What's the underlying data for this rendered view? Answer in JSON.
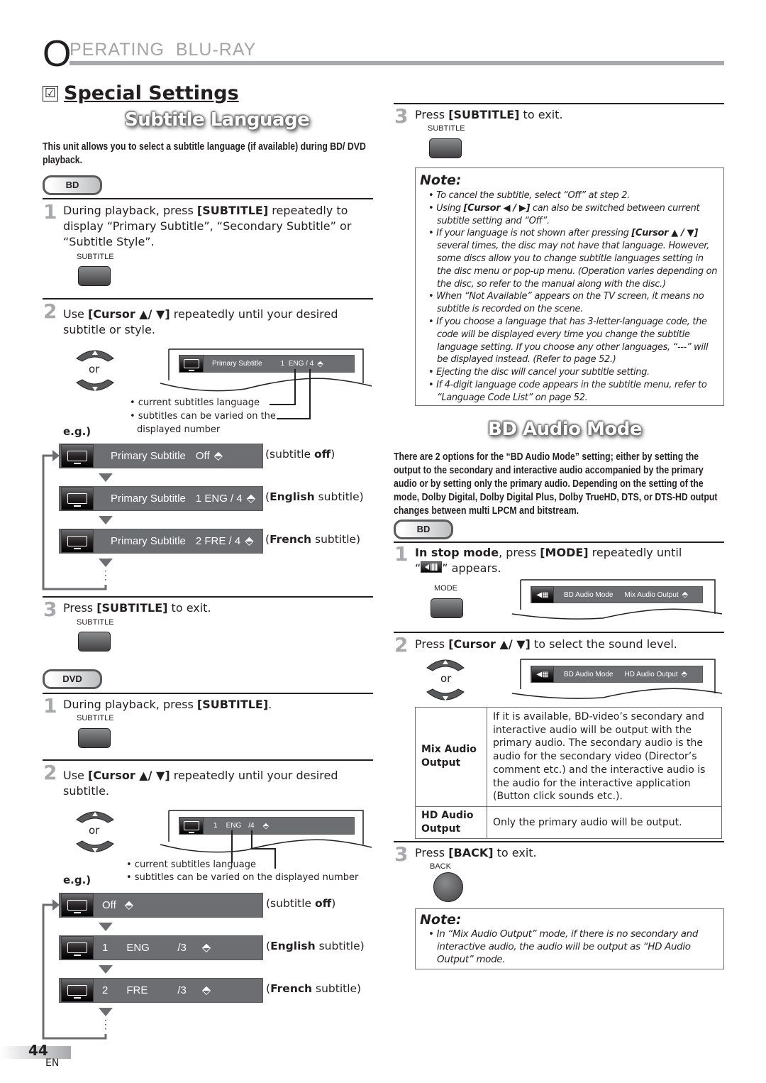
{
  "header": {
    "initial": "O",
    "rest": "PERATING  BLU-RAY"
  },
  "section": {
    "checkbox": "☑",
    "title": "Special Settings"
  },
  "subtitle_language": {
    "banner": "Subtitle Language",
    "intro": "This unit allows you to select a subtitle language (if available) during BD/ DVD playback.",
    "bd": {
      "badge": "BD",
      "step1": {
        "num": "1",
        "text_before": "During playback, press ",
        "key": "[SUBTITLE]",
        "text_after": " repeatedly to display “Primary Subtitle”, “Secondary Subtitle” or “Subtitle Style”.",
        "key_label": "SUBTITLE"
      },
      "step2": {
        "num": "2",
        "text_before": "Use ",
        "key": "[Cursor ▲/ ▼]",
        "text_after": " repeatedly until your desired subtitle or style.",
        "or": "or",
        "osd": {
          "label": "Primary Subtitle",
          "value": "1  ENG / 4"
        },
        "callout_1": "• current subtitles language",
        "callout_2": "• subtitles can be varied on the",
        "callout_3": "displayed number",
        "eg": "e.g.)",
        "examples": [
          {
            "label": "Primary Subtitle",
            "value": "Off",
            "caption_pre": "(subtitle ",
            "caption_bold": "off",
            "caption_post": ")"
          },
          {
            "label": "Primary Subtitle",
            "value": "1 ENG / 4",
            "caption_pre": "(",
            "caption_bold": "English",
            "caption_post": " subtitle)"
          },
          {
            "label": "Primary Subtitle",
            "value": "2 FRE / 4",
            "caption_pre": "(",
            "caption_bold": "French",
            "caption_post": " subtitle)"
          }
        ]
      },
      "step3": {
        "num": "3",
        "text_before": "Press ",
        "key": "[SUBTITLE]",
        "text_after": " to exit.",
        "key_label": "SUBTITLE"
      }
    },
    "dvd": {
      "badge": "DVD",
      "step1": {
        "num": "1",
        "text_before": "During playback, press ",
        "key": "[SUBTITLE]",
        "text_after": ".",
        "key_label": "SUBTITLE"
      },
      "step2": {
        "num": "2",
        "text_before": "Use ",
        "key": "[Cursor ▲/ ▼]",
        "text_after": " repeatedly until your desired subtitle.",
        "or": "or",
        "osd": {
          "num": "1",
          "lang": "ENG",
          "total": "/4"
        },
        "callout_1": "• current subtitles language",
        "callout_2": "• subtitles can be varied on the displayed number",
        "eg": "e.g.)",
        "examples": [
          {
            "num": "Off",
            "lang": "",
            "total": "",
            "caption_pre": "(subtitle ",
            "caption_bold": "off",
            "caption_post": ")"
          },
          {
            "num": "1",
            "lang": "ENG",
            "total": "/3",
            "caption_pre": "(",
            "caption_bold": "English",
            "caption_post": " subtitle)"
          },
          {
            "num": "2",
            "lang": "FRE",
            "total": "/3",
            "caption_pre": "(",
            "caption_bold": "French",
            "caption_post": " subtitle)"
          }
        ]
      }
    },
    "step3_right": {
      "num": "3",
      "text_before": "Press ",
      "key": "[SUBTITLE]",
      "text_after": " to exit.",
      "key_label": "SUBTITLE"
    },
    "note": {
      "title": "Note:",
      "items": [
        {
          "pre": "To cancel the subtitle, select “Off” at step 2.",
          "bold": "",
          "post": ""
        },
        {
          "pre": "Using ",
          "bold": "[Cursor ◀ / ▶]",
          "post": " can also be switched between current subtitle setting and “Off”."
        },
        {
          "pre": "If your language is not shown after pressing ",
          "bold": "[Cursor ▲ / ▼]",
          "post": " several times, the disc may not have that language. However, some discs allow you to change subtitle languages setting in the disc menu or pop-up menu. (Operation varies depending on the disc, so refer to the manual along with the disc.)"
        },
        {
          "pre": "When “Not Available” appears on the TV screen, it means no subtitle is recorded on the scene.",
          "bold": "",
          "post": ""
        },
        {
          "pre": "If you choose a language that has 3-letter-language code, the code will be displayed every time you change the subtitle language setting. If you choose any other languages, “---” will be displayed instead. (Refer to page 52.)",
          "bold": "",
          "post": ""
        },
        {
          "pre": "Ejecting the disc will cancel your subtitle setting.",
          "bold": "",
          "post": ""
        },
        {
          "pre": "If 4-digit language code appears in the subtitle menu, refer to “Language Code List” on page 52.",
          "bold": "",
          "post": ""
        }
      ]
    }
  },
  "bd_audio_mode": {
    "banner": "BD Audio Mode",
    "intro": "There are 2 options for the “BD Audio Mode” setting; either by setting the output to the secondary and interactive audio accompanied by the primary audio or by setting only the primary audio. Depending on the setting of the mode, Dolby Digital, Dolby Digital Plus, Dolby TrueHD, DTS, or DTS-HD output changes between multi LPCM and bitstream.",
    "badge": "BD",
    "step1": {
      "num": "1",
      "bold_lead": "In stop mode",
      "text_before": ", press ",
      "key": "[MODE]",
      "text_after": " repeatedly until",
      "line2_pre": "“",
      "line2_post": "” appears.",
      "key_label": "MODE",
      "osd": {
        "label": "BD Audio Mode",
        "value": "Mix Audio Output"
      }
    },
    "step2": {
      "num": "2",
      "text_before": "Press ",
      "key": "[Cursor ▲/ ▼]",
      "text_after": " to select the sound level.",
      "or": "or",
      "osd": {
        "label": "BD Audio Mode",
        "value": "HD Audio Output"
      }
    },
    "table": [
      {
        "name": "Mix Audio Output",
        "desc": "If it is available, BD-video’s secondary and interactive audio will be output with the primary audio. The secondary audio is the audio for the secondary video (Director’s comment etc.) and the interactive audio is the audio for the interactive application (Button click sounds etc.)."
      },
      {
        "name": "HD Audio Output",
        "desc": "Only the primary audio will be output."
      }
    ],
    "step3": {
      "num": "3",
      "text_before": "Press ",
      "key": "[BACK]",
      "text_after": " to exit.",
      "key_label": "BACK"
    },
    "note": {
      "title": "Note:",
      "items": [
        "In “Mix Audio Output” mode, if there is no secondary and interactive audio, the audio will be output as “HD Audio Output” mode."
      ]
    }
  },
  "footer": {
    "page": "44",
    "lang": "EN"
  }
}
